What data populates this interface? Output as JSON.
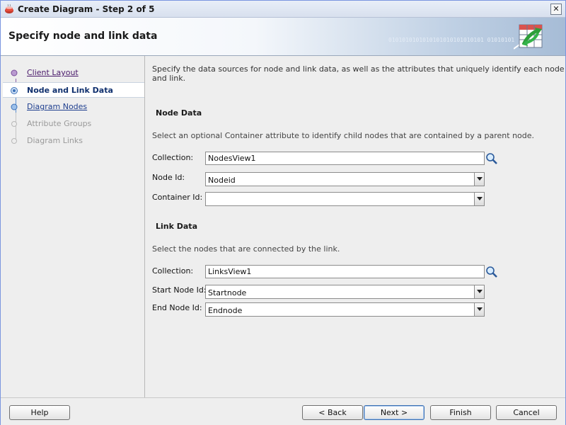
{
  "window": {
    "title": "Create Diagram - Step 2 of 5",
    "close_glyph": "✕"
  },
  "header": {
    "title": "Specify node and link data",
    "binary_text": "0101010101010101010101010101 01010101"
  },
  "steps": [
    {
      "label": "Client Layout",
      "state": "visited"
    },
    {
      "label": "Node and Link Data",
      "state": "current"
    },
    {
      "label": "Diagram Nodes",
      "state": "link"
    },
    {
      "label": "Attribute Groups",
      "state": "disabled"
    },
    {
      "label": "Diagram Links",
      "state": "disabled"
    }
  ],
  "content": {
    "intro": "Specify the data sources for node and link data, as well as the attributes that uniquely identify each node and link.",
    "node_data": {
      "title": "Node Data",
      "description": "Select an optional Container attribute to identify child nodes that are contained by a parent node.",
      "collection_label": "Collection:",
      "collection_value": "NodesView1",
      "node_id_label": "Node Id:",
      "node_id_value": "Nodeid",
      "container_id_label": "Container Id:",
      "container_id_value": ""
    },
    "link_data": {
      "title": "Link Data",
      "description": "Select the nodes that are connected by the link.",
      "collection_label": "Collection:",
      "collection_value": "LinksView1",
      "start_node_label": "Start Node Id:",
      "start_node_value": "Startnode",
      "end_node_label": "End Node Id:",
      "end_node_value": "Endnode"
    }
  },
  "footer": {
    "help": "Help",
    "back": "< Back",
    "next": "Next >",
    "finish": "Finish",
    "cancel": "Cancel"
  },
  "colors": {
    "accent": "#10306e",
    "header_gradient_end": "#a6bcd6",
    "link": "#1f3f8f"
  },
  "icons": {
    "app": "app-cup-icon",
    "wizard": "wizard-diagram-icon",
    "search": "search-icon",
    "dropdown": "chevron-down-icon"
  }
}
